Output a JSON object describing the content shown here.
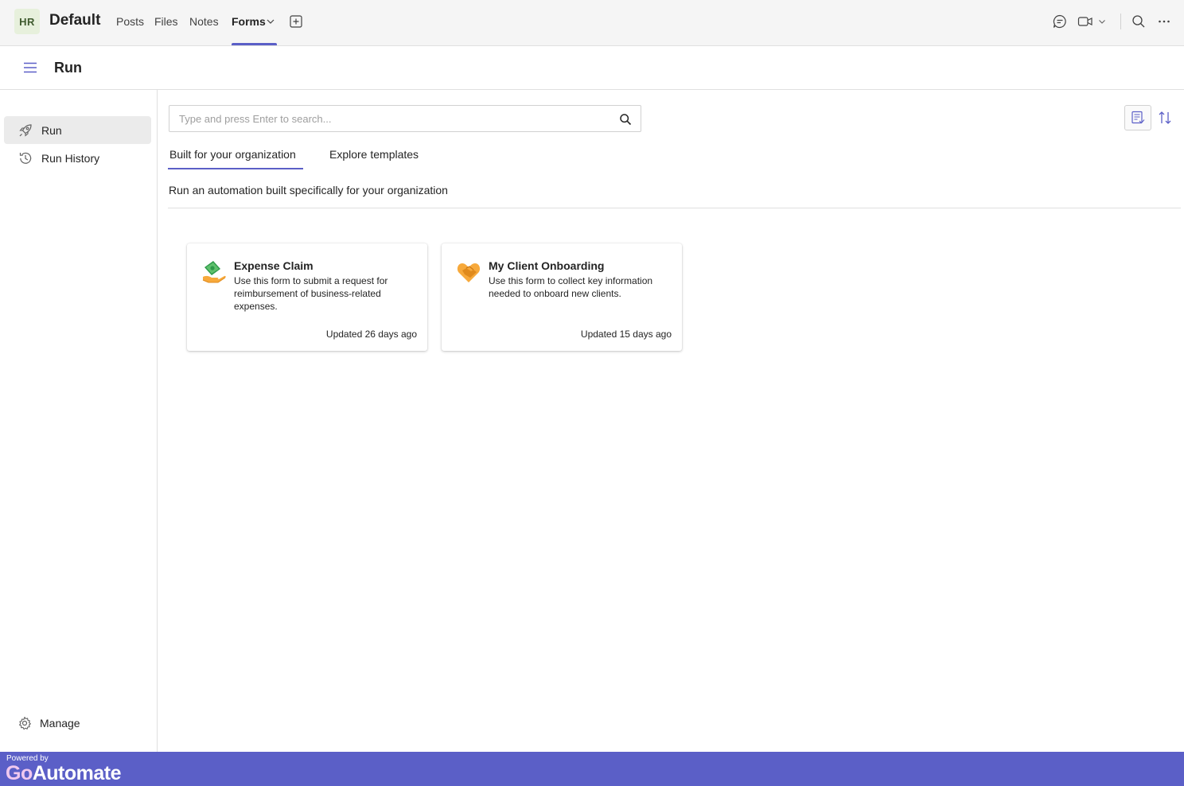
{
  "topbar": {
    "avatar": "HR",
    "team_name": "Default",
    "tabs": [
      {
        "label": "Posts"
      },
      {
        "label": "Files"
      },
      {
        "label": "Notes"
      },
      {
        "label": "Forms"
      }
    ]
  },
  "app": {
    "title": "Run"
  },
  "sidebar": {
    "items": [
      {
        "label": "Run"
      },
      {
        "label": "Run History"
      }
    ],
    "manage_label": "Manage"
  },
  "search": {
    "placeholder": "Type and press Enter to search..."
  },
  "subtabs": [
    {
      "label": "Built for your organization"
    },
    {
      "label": "Explore templates"
    }
  ],
  "description": "Run an automation built specifically for your organization",
  "cards": [
    {
      "title": "Expense Claim",
      "description": "Use this form to submit a request for reimbursement of business-related expenses.",
      "updated": "Updated 26 days ago",
      "icon": "money-hand-icon"
    },
    {
      "title": "My Client Onboarding",
      "description": "Use this form to collect key information needed to onboard new clients.",
      "updated": "Updated 15 days ago",
      "icon": "handshake-icon"
    }
  ],
  "footer": {
    "powered_by": "Powered by",
    "brand_prefix": "Go",
    "brand_suffix": "Automate"
  },
  "colors": {
    "accent": "#5b5fc7",
    "avatar_bg": "#e7f0dc"
  }
}
